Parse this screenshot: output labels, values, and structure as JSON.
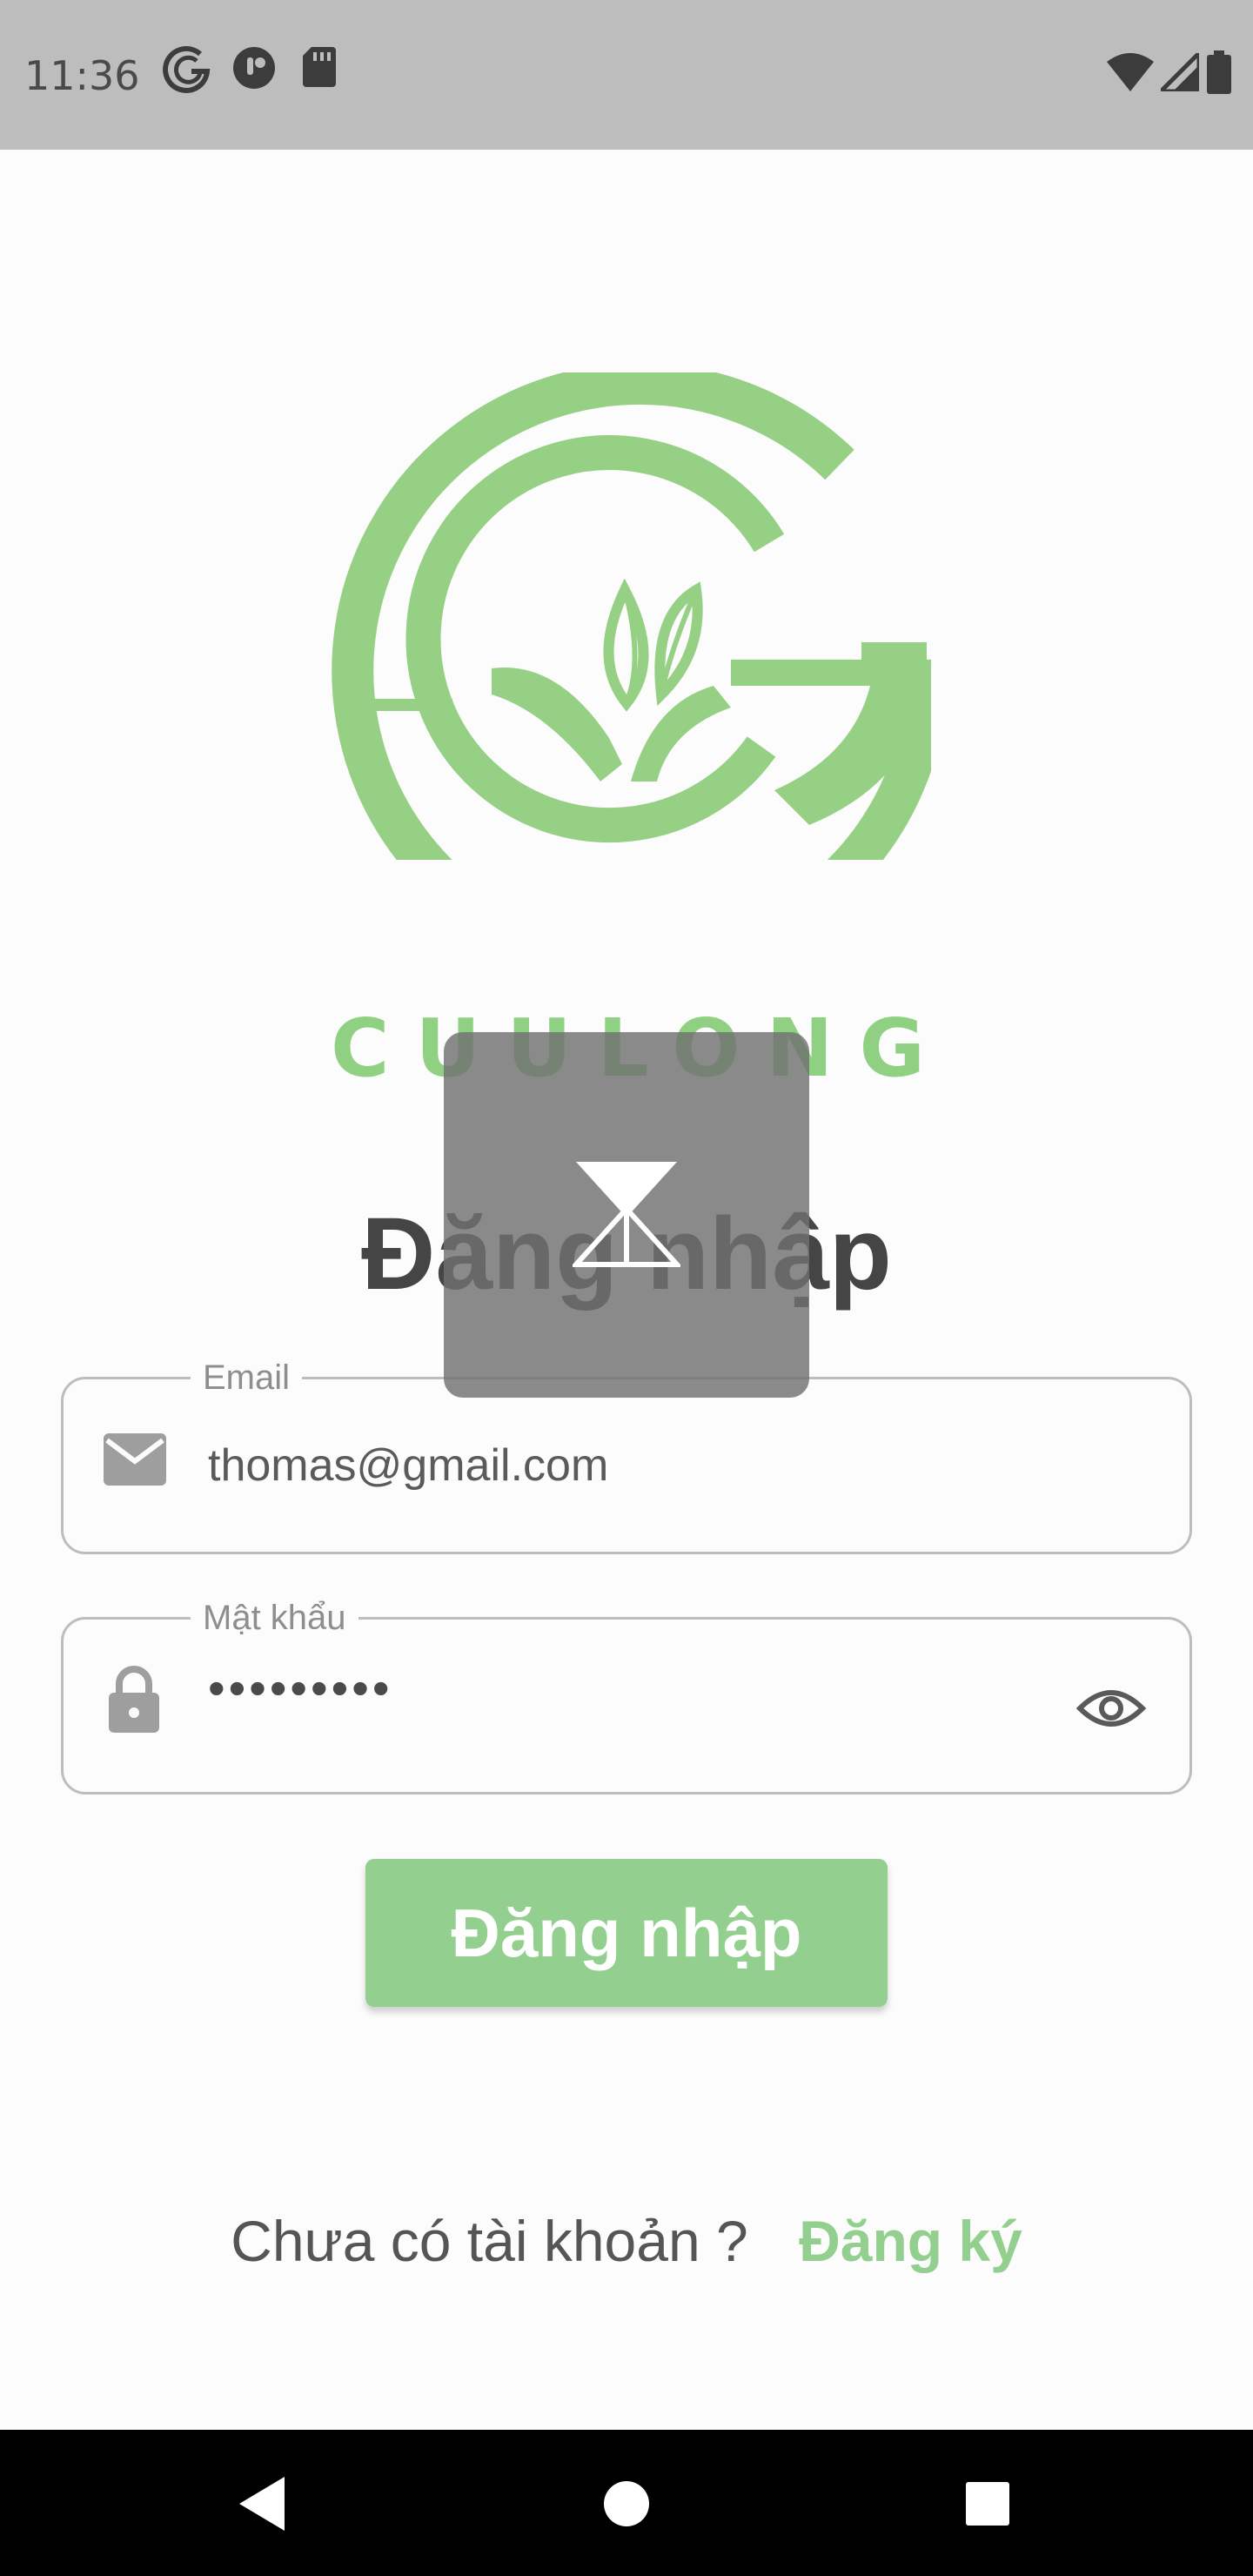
{
  "status_bar": {
    "time": "11:36",
    "icons_left": [
      "cuulong-app-icon",
      "pocket-icon",
      "sd-card-icon"
    ],
    "icons_right": [
      "wifi-icon",
      "signal-icon",
      "battery-icon"
    ]
  },
  "brand": {
    "logo_icon": "cuulong-leaf-logo-icon",
    "wordmark": "CUULONG",
    "color": "#8fd082"
  },
  "page": {
    "title": "Đăng nhập"
  },
  "form": {
    "email": {
      "label": "Email",
      "value": "thomas@gmail.com",
      "icon": "mail-icon"
    },
    "password": {
      "label": "Mật khẩu",
      "value": "•••••••••",
      "icon": "lock-icon",
      "toggle_icon": "eye-icon"
    },
    "submit_label": "Đăng nhập"
  },
  "signup": {
    "prompt": "Chưa có tài khoản ?",
    "link": "Đăng ký"
  },
  "overlay": {
    "icon": "hourglass-icon"
  },
  "nav_bar": {
    "buttons": [
      "back-icon",
      "home-icon",
      "recents-icon"
    ]
  },
  "colors": {
    "accent": "#93cf8e",
    "status_bar": "#bdbdbd",
    "title": "#454545"
  }
}
